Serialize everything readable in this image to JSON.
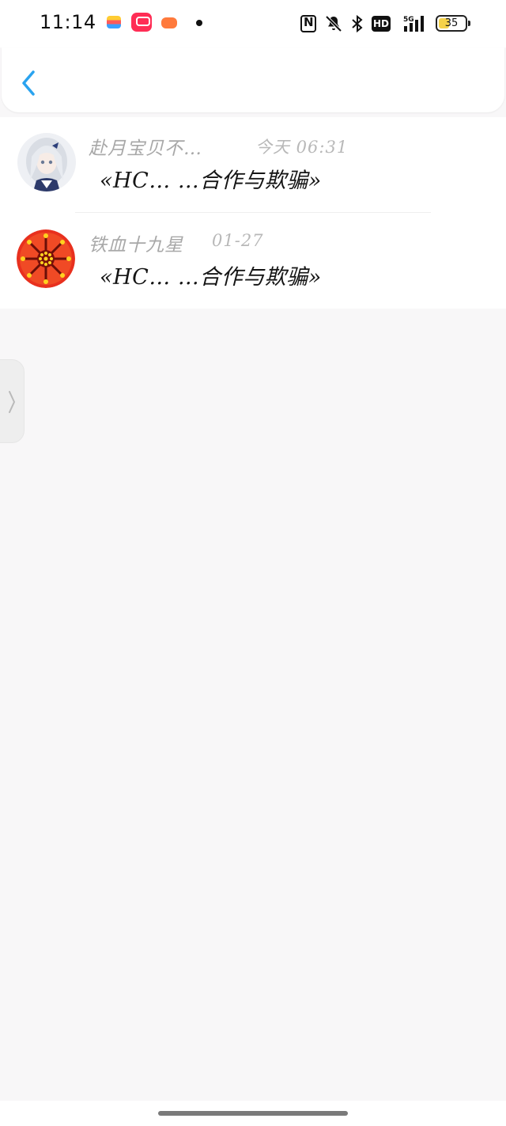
{
  "status_bar": {
    "time": "11:14",
    "battery": "35",
    "hd_label": "HD",
    "network": "5G"
  },
  "header": {
    "back_icon": "chevron-left-icon",
    "accent": "#2aa3ef"
  },
  "list": {
    "items": [
      {
        "author": "赴月宝贝不…",
        "timestamp": "今天 06:31",
        "title": "«HC… …合作与欺骗»",
        "avatar": "anime-girl-avatar"
      },
      {
        "author": "铁血十九星",
        "timestamp": "01-27",
        "title": "«HC… …合作与欺骗»",
        "avatar": "red-star-emblem-avatar"
      }
    ]
  },
  "edge_handle": {
    "icon": "chevron-right-icon"
  }
}
